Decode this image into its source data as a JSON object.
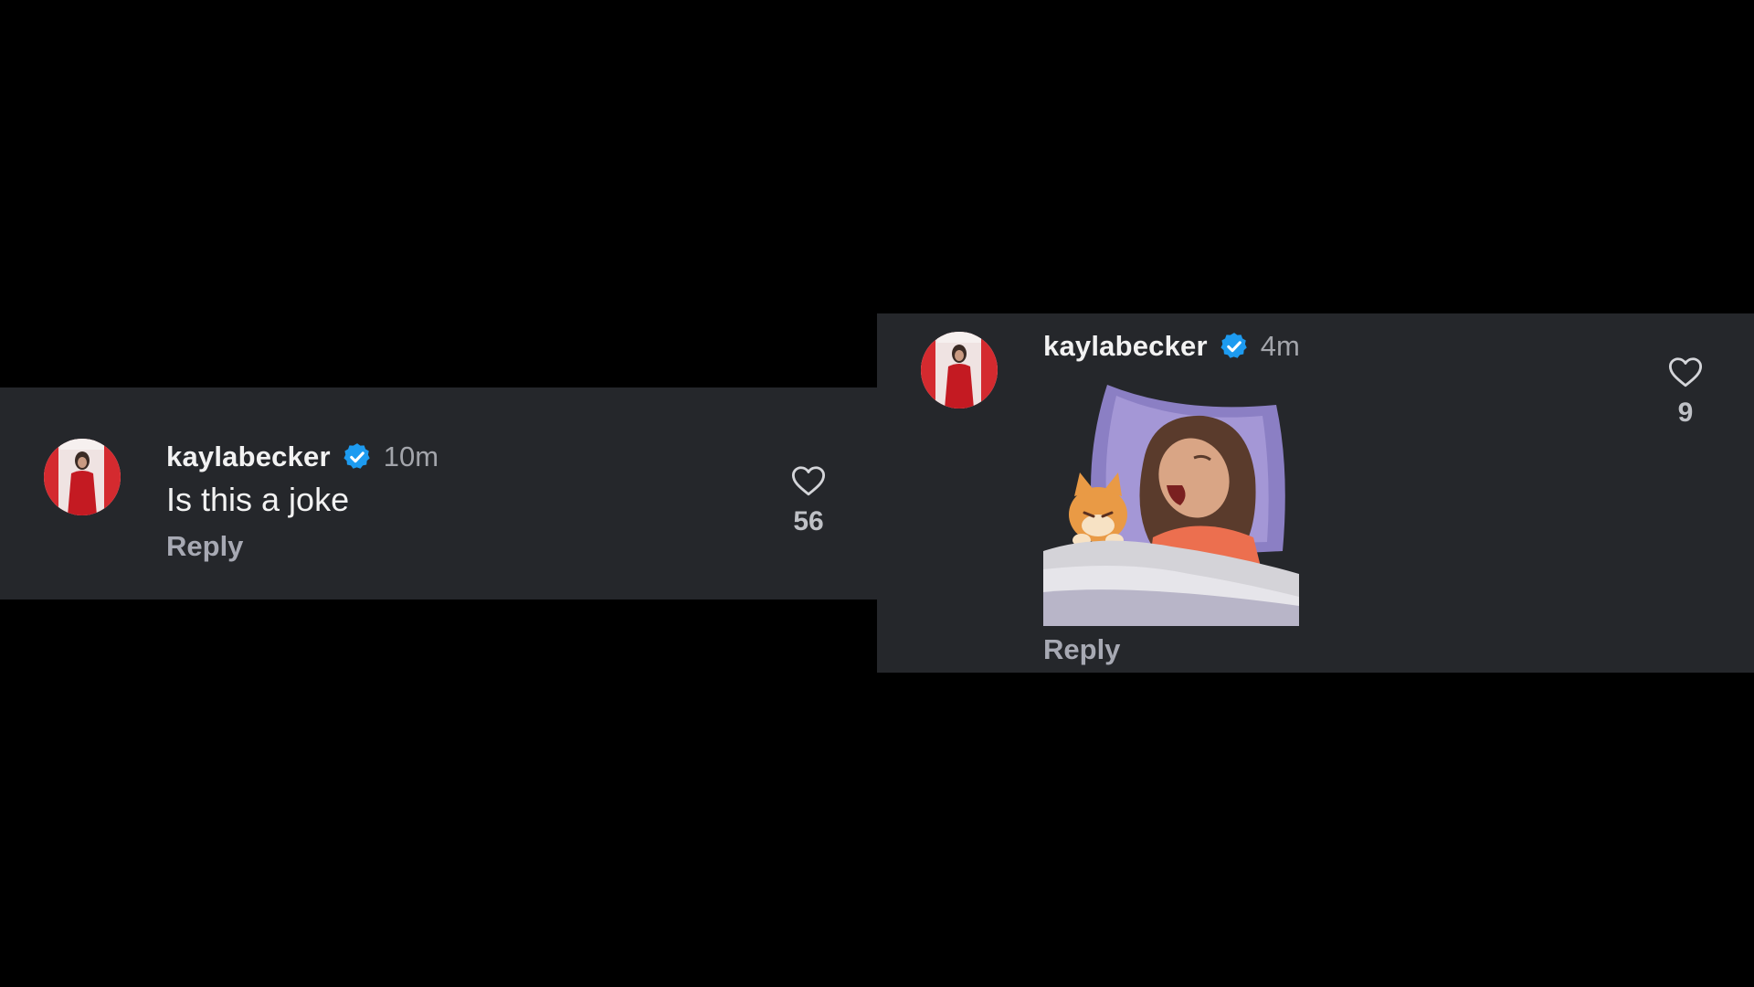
{
  "comments": [
    {
      "username": "kaylabecker",
      "verified": true,
      "timestamp": "10m",
      "text": "Is this a joke",
      "reply_label": "Reply",
      "like_count": "56"
    },
    {
      "username": "kaylabecker",
      "verified": true,
      "timestamp": "4m",
      "sticker": "sleeping-woman-with-cat-sticker",
      "reply_label": "Reply",
      "like_count": "9"
    }
  ],
  "colors": {
    "page_background": "#000000",
    "panel_background": "#25272b",
    "username": "#f2f2f2",
    "timestamp": "#a3a5ab",
    "reply": "#a7a9b3",
    "verified_badge": "#1d9bf0"
  },
  "icons": {
    "heart": "heart-outline-icon",
    "verified": "verified-badge-icon"
  }
}
